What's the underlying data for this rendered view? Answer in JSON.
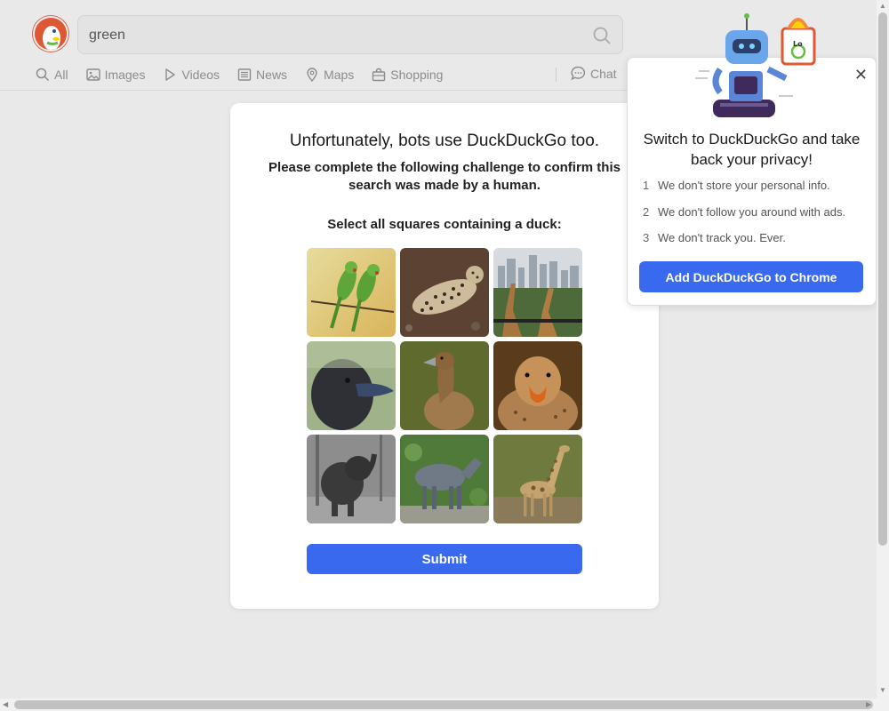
{
  "search": {
    "value": "green"
  },
  "tabs": [
    {
      "label": "All",
      "icon": "search-icon"
    },
    {
      "label": "Images",
      "icon": "image-icon"
    },
    {
      "label": "Videos",
      "icon": "play-icon"
    },
    {
      "label": "News",
      "icon": "newspaper-icon"
    },
    {
      "label": "Maps",
      "icon": "map-pin-icon"
    },
    {
      "label": "Shopping",
      "icon": "shopping-bag-icon"
    }
  ],
  "chat": {
    "label": "Chat",
    "icon": "chat-bubble-icon"
  },
  "captcha": {
    "title": "Unfortunately, bots use DuckDuckGo too.",
    "subtitle": "Please complete the following challenge to confirm this search was made by a human.",
    "instruction": "Select all squares containing a duck:",
    "tiles": [
      "parakeets",
      "leopard",
      "giraffes-city",
      "duck-closeup",
      "brown-duck",
      "duck-face",
      "elephant",
      "nilgai",
      "giraffe"
    ],
    "submit_label": "Submit"
  },
  "promo": {
    "title": "Switch to DuckDuckGo and take back your privacy!",
    "items": [
      {
        "num": "1",
        "text": "We don't store your personal info."
      },
      {
        "num": "2",
        "text": "We don't follow you around with ads."
      },
      {
        "num": "3",
        "text": "We don't track you. Ever."
      }
    ],
    "button_label": "Add DuckDuckGo to Chrome",
    "close_symbol": "✕"
  },
  "colors": {
    "accent": "#3969ef",
    "background": "#e9e9e9"
  }
}
